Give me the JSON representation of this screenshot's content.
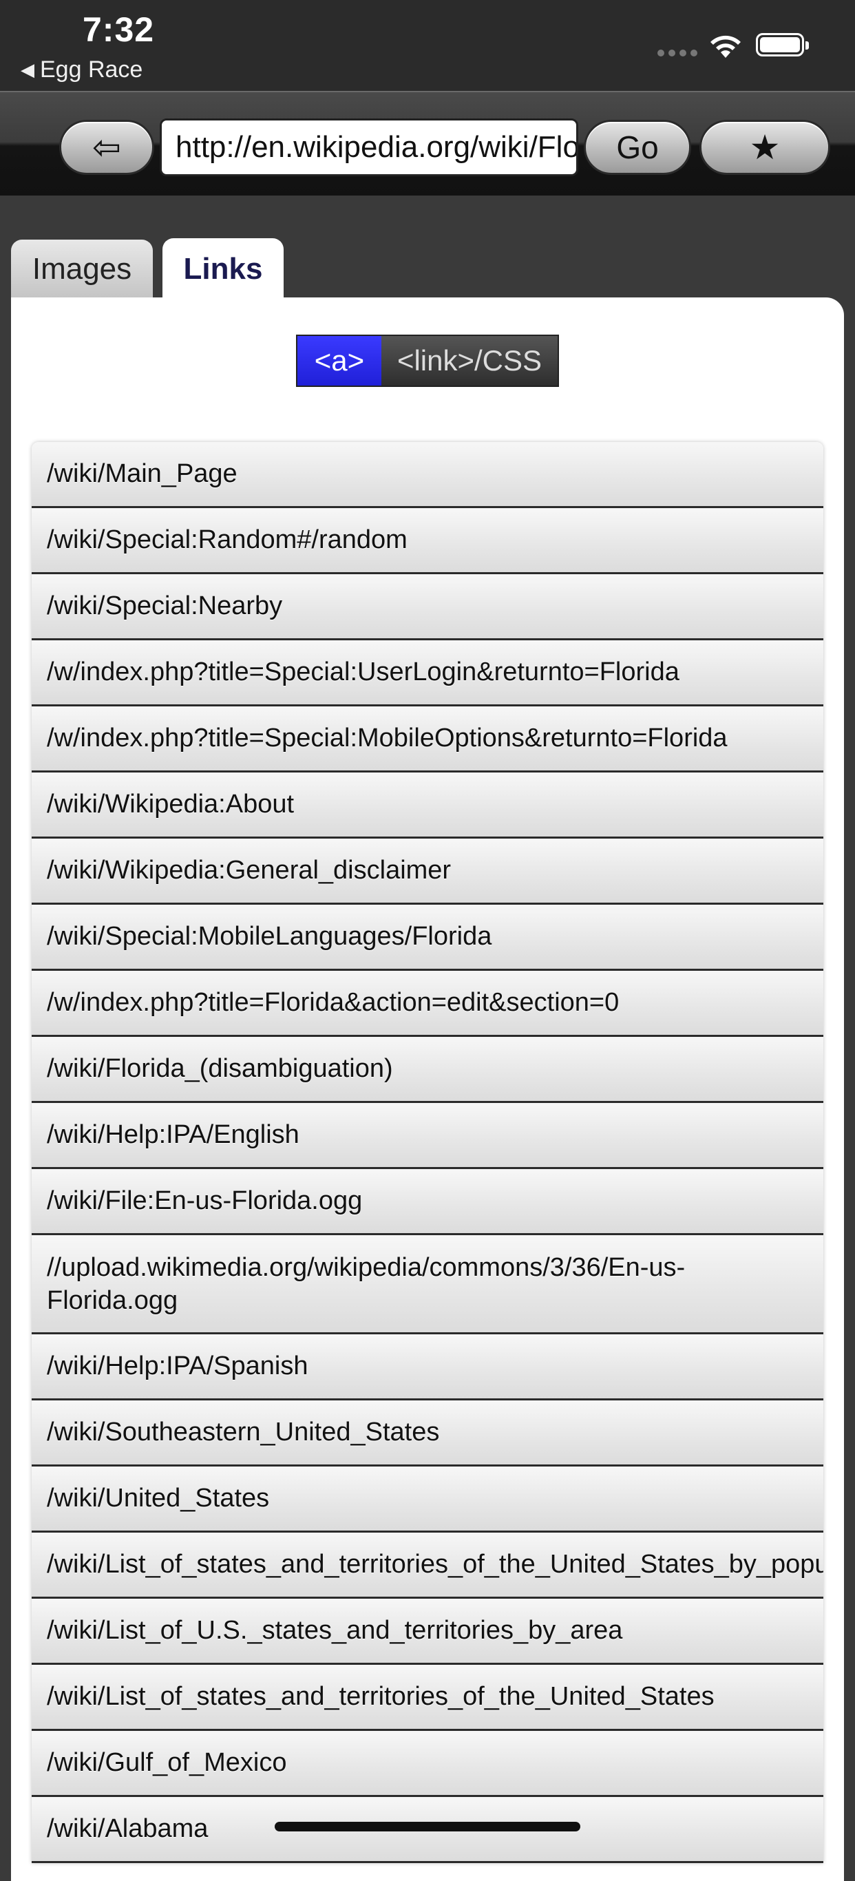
{
  "status_bar": {
    "time": "7:32",
    "back_app": "Egg Race"
  },
  "toolbar": {
    "back_glyph": "⇦",
    "url": "http://en.wikipedia.org/wiki/Florida",
    "go_label": "Go",
    "bookmark_glyph": "★"
  },
  "tabs": [
    {
      "label": "Images",
      "active": false
    },
    {
      "label": "Links",
      "active": true
    }
  ],
  "segmented": {
    "a_label": "<a>",
    "css_label": "<link>/CSS",
    "selected": "<a>"
  },
  "links": [
    "/wiki/Main_Page",
    "/wiki/Special:Random#/random",
    "/wiki/Special:Nearby",
    "/w/index.php?title=Special:UserLogin&returnto=Florida",
    "/w/index.php?title=Special:MobileOptions&returnto=Florida",
    "/wiki/Wikipedia:About",
    "/wiki/Wikipedia:General_disclaimer",
    "/wiki/Special:MobileLanguages/Florida",
    "/w/index.php?title=Florida&action=edit&section=0",
    "/wiki/Florida_(disambiguation)",
    "/wiki/Help:IPA/English",
    "/wiki/File:En-us-Florida.ogg",
    "//upload.wikimedia.org/wikipedia/commons/3/36/En-us-Florida.ogg",
    "/wiki/Help:IPA/Spanish",
    "/wiki/Southeastern_United_States",
    "/wiki/United_States",
    "/wiki/List_of_states_and_territories_of_the_United_States_by_population",
    "/wiki/List_of_U.S._states_and_territories_by_area",
    "/wiki/List_of_states_and_territories_of_the_United_States",
    "/wiki/Gulf_of_Mexico",
    "/wiki/Alabama"
  ],
  "colors": {
    "segment_selected": "#2a2aee",
    "link_tab_text": "#1a1a50"
  }
}
